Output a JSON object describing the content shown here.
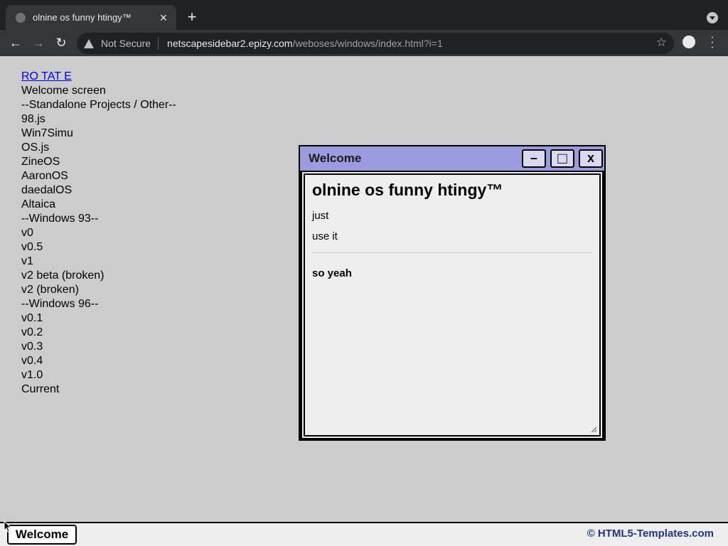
{
  "browser": {
    "tab_title": "olnine os funny htingy™",
    "tab_close": "×",
    "new_tab": "+",
    "security_label": "Not Secure",
    "url_host": "netscapesidebar2.epizy.com",
    "url_path": "/weboses/windows/index.html?i=1",
    "back_glyph": "←",
    "forward_glyph": "→",
    "reload_glyph": "↻",
    "star_glyph": "☆"
  },
  "links": {
    "rotate": "RO TAT E",
    "items": [
      "Welcome screen",
      "--Standalone Projects / Other--",
      "98.js",
      "Win7Simu",
      "OS.js",
      "ZineOS",
      "AaronOS",
      "daedalOS",
      "Altaica",
      "--Windows 93--",
      "v0",
      "v0.5",
      "v1",
      "v2 beta (broken)",
      "v2 (broken)",
      "--Windows 96--",
      "v0.1",
      "v0.2",
      "v0.3",
      "v0.4",
      "v1.0",
      "Current"
    ]
  },
  "window": {
    "title": "Welcome",
    "minimize": "–",
    "maximize": "□",
    "close": "x",
    "heading": "olnine os funny htingy™",
    "line1": "just",
    "line2": "use it",
    "footer": "so yeah"
  },
  "taskbar": {
    "task_label": "Welcome",
    "credit": "© HTML5-Templates.com"
  },
  "colors": {
    "page_bg": "#cccccc",
    "title_bar": "#9b9be0",
    "link": "#0000ee",
    "credit": "#20348a"
  }
}
